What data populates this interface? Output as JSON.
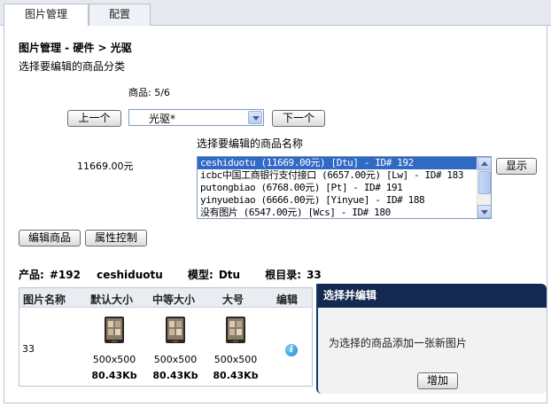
{
  "tabs": [
    {
      "label": "图片管理",
      "active": true
    },
    {
      "label": "配置",
      "active": false
    }
  ],
  "breadcrumb": "图片管理 - 硬件 > 光驱",
  "subtitle": "选择要编辑的商品分类",
  "product_count": "商品: 5/6",
  "nav": {
    "prev_label": "上一个",
    "next_label": "下一个",
    "category_selected": "光驱*"
  },
  "product_list": {
    "label": "选择要编辑的商品名称",
    "selected_price": "11669.00元",
    "show_label": "显示",
    "items": [
      {
        "text": "ceshiduotu (11669.00元) [Dtu] - ID# 192",
        "selected": true
      },
      {
        "text": "icbc中国工商银行支付接口 (6657.00元) [Lw] - ID# 183",
        "selected": false
      },
      {
        "text": "putongbiao (6768.00元) [Pt] - ID# 191",
        "selected": false
      },
      {
        "text": "yinyuebiao (6666.00元) [Yinyue] - ID# 188",
        "selected": false
      },
      {
        "text": "没有图片 (6547.00元) [Wcs] - ID# 180",
        "selected": false
      }
    ]
  },
  "actions": {
    "edit_label": "编辑商品",
    "attr_label": "属性控制"
  },
  "product_info": {
    "product_label": "产品:",
    "product_value": "#192",
    "product_name": "ceshiduotu",
    "model_label": "模型:",
    "model_value": "Dtu",
    "dir_label": "根目录:",
    "dir_value": "33"
  },
  "image_table": {
    "headers": [
      "图片名称",
      "默认大小",
      "中等大小",
      "大号",
      "编辑"
    ],
    "row": {
      "name": "33",
      "images": [
        {
          "dim": "500x500",
          "size": "80.43Kb"
        },
        {
          "dim": "500x500",
          "size": "80.43Kb"
        },
        {
          "dim": "500x500",
          "size": "80.43Kb"
        }
      ]
    }
  },
  "edit_panel": {
    "title": "选择并编辑",
    "description": "为选择的商品添加一张新图片",
    "add_label": "增加"
  },
  "colors": {
    "panel_header": "#13294f",
    "selection": "#316ac5"
  }
}
